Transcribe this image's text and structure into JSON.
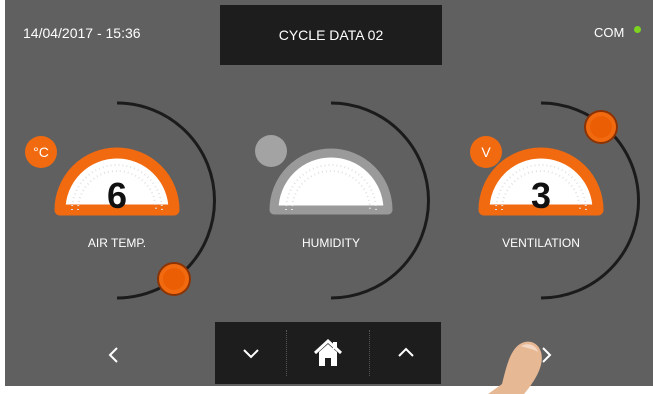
{
  "header": {
    "datetime": "14/04/2017 - 15:36",
    "title": "CYCLE DATA 02",
    "status_label": "COM",
    "status_color": "#7ed321"
  },
  "dials": [
    {
      "id": "air-temp",
      "value": "6",
      "unit": "°C",
      "label": "AIR TEMP.",
      "active": true,
      "accent": "#f26a0f"
    },
    {
      "id": "humidity",
      "value": "",
      "unit": "",
      "label": "HUMIDITY",
      "active": false,
      "accent": "#9a9a9a"
    },
    {
      "id": "ventilation",
      "value": "3",
      "unit": "V",
      "label": "VENTILATION",
      "active": true,
      "accent": "#f26a0f"
    }
  ],
  "footer": {
    "icons": {
      "previous": "chevron-left-icon",
      "next": "chevron-right-icon",
      "down": "chevron-down-icon",
      "home": "home-icon",
      "up": "chevron-up-icon"
    }
  }
}
